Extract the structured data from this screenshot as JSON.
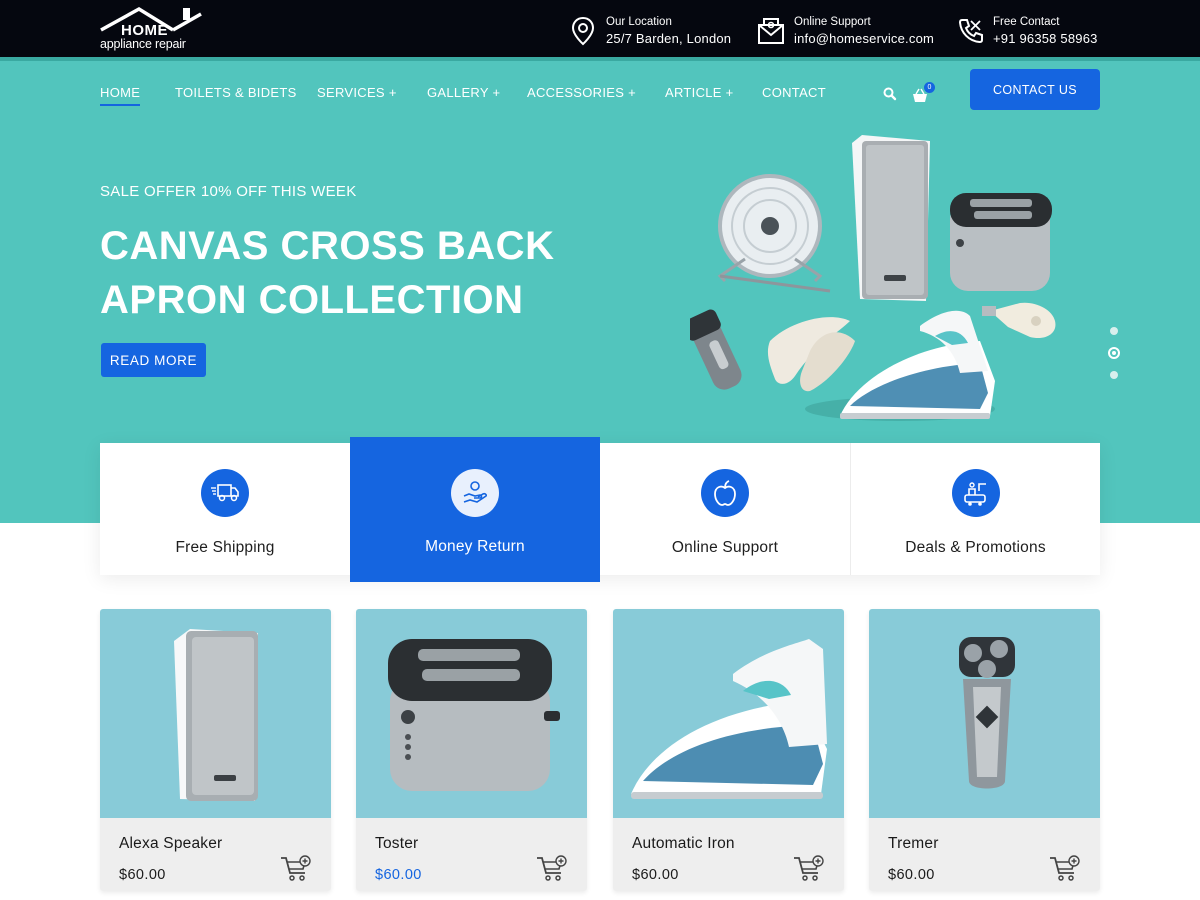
{
  "brand": {
    "logo_home": "HOME",
    "logo_sub": "appliance repair",
    "accent_color": "#1565e0",
    "hero_color": "#52c5bd",
    "topbar_color": "#05070f"
  },
  "topbar": {
    "location": {
      "label": "Our Location",
      "value": "25/7 Barden, London",
      "icon": "location-pin-icon"
    },
    "support": {
      "label": "Online Support",
      "value": "info@homeservice.com",
      "icon": "mail-icon"
    },
    "contact": {
      "label": "Free Contact",
      "value": "+91 96358 58963",
      "icon": "phone-icon"
    }
  },
  "nav": {
    "items": [
      {
        "label": "HOME",
        "active": true
      },
      {
        "label": "TOILETS & BIDETS"
      },
      {
        "label": "SERVICES +"
      },
      {
        "label": "GALLERY +"
      },
      {
        "label": "ACCESSORIES +"
      },
      {
        "label": "ARTICLE +"
      },
      {
        "label": "CONTACT"
      }
    ],
    "cart_count": "0",
    "contact_button": "CONTACT US"
  },
  "hero": {
    "offer": "SALE OFFER 10% OFF THIS WEEK",
    "title_line1": "CANVAS CROSS BACK",
    "title_line2": "APRON COLLECTION",
    "button": "READ MORE",
    "slides": 3,
    "active_slide": 2
  },
  "features": [
    {
      "label": "Free Shipping",
      "icon": "truck-icon"
    },
    {
      "label": "Money Return",
      "icon": "money-hand-icon",
      "highlight": true
    },
    {
      "label": "Online Support",
      "icon": "apple-icon"
    },
    {
      "label": "Deals & Promotions",
      "icon": "promotion-icon"
    }
  ],
  "products": [
    {
      "name": "Alexa Speaker",
      "price": "$60.00"
    },
    {
      "name": "Toster",
      "price": "$60.00",
      "price_highlight": true
    },
    {
      "name": "Automatic Iron",
      "price": "$60.00"
    },
    {
      "name": "Tremer",
      "price": "$60.00"
    }
  ]
}
